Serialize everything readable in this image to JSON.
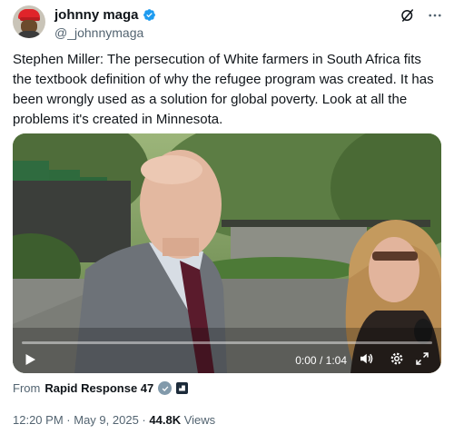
{
  "tweet": {
    "author": {
      "display_name": "johnny maga",
      "handle": "@_johnnymaga",
      "verified": true,
      "avatar_icon": "avatar-red-cap"
    },
    "header_icons": [
      "grok-icon",
      "more-icon"
    ],
    "text": "Stephen Miller: The persecution of White farmers in South Africa fits the textbook definition of why the refugee program was created. It has been wrongly used as a solution for global poverty. Look at all the problems it's created in Minnesota.",
    "video": {
      "current_time": "0:00",
      "separator": "/",
      "duration": "1:04",
      "progress": 0,
      "controls": [
        "play-icon",
        "volume-icon",
        "settings-icon",
        "fullscreen-icon"
      ]
    },
    "source": {
      "from_label": "From",
      "name": "Rapid Response 47",
      "badge_icon": "government-badge-icon",
      "affiliation_icon": "flag-icon"
    },
    "meta": {
      "time": "12:20 PM",
      "separator": "·",
      "date": "May 9, 2025",
      "views_count": "44.8K",
      "views_label": "Views"
    }
  },
  "colors": {
    "accent": "#1d9bf0",
    "text": "#0f1419",
    "secondary": "#536471"
  }
}
